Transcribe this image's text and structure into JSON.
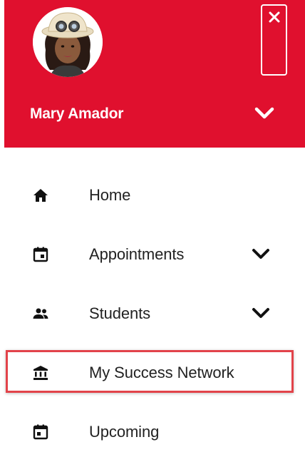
{
  "user": {
    "name": "Mary Amador"
  },
  "menu": {
    "items": [
      {
        "label": "Home",
        "icon": "home-icon",
        "expandable": false
      },
      {
        "label": "Appointments",
        "icon": "calendar-icon",
        "expandable": true
      },
      {
        "label": "Students",
        "icon": "people-icon",
        "expandable": true
      },
      {
        "label": "My Success Network",
        "icon": "institution-icon",
        "expandable": false,
        "highlighted": true
      },
      {
        "label": "Upcoming",
        "icon": "calendar-icon",
        "expandable": false
      }
    ]
  },
  "colors": {
    "header_bg": "#e0102e",
    "highlight_border": "#e2434a",
    "text": "#222222"
  }
}
